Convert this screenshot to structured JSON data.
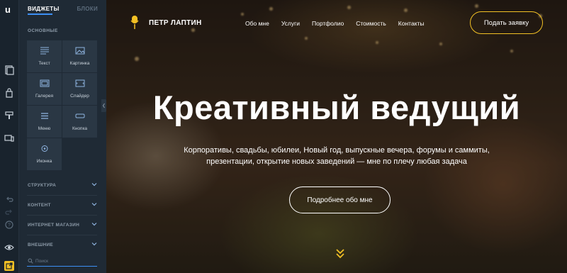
{
  "rail": {
    "logo": "u"
  },
  "panel": {
    "tabs": {
      "widgets": "ВИДЖЕТЫ",
      "blocks": "БЛОКИ"
    },
    "basic_title": "ОСНОВНЫЕ",
    "widgets": [
      "Текст",
      "Картинка",
      "Галерея",
      "Слайдер",
      "Меню",
      "Кнопка",
      "Иконка"
    ],
    "sections": [
      "СТРУКТУРА",
      "КОНТЕНТ",
      "ИНТЕРНЕТ МАГАЗИН",
      "ВНЕШНИЕ"
    ],
    "search_placeholder": "Поиск"
  },
  "site": {
    "brand": "ПЕТР ЛАПТИН",
    "menu": [
      "Обо мне",
      "Услуги",
      "Портфолио",
      "Стоимость",
      "Контакты"
    ],
    "cta": "Подать заявку",
    "headline": "Креативный ведущий",
    "subtitle": "Корпоративы, свадьбы, юбилеи, Новый год, выпускные вечера, форумы и саммиты, презентации, открытие новых заведений — мне по плечу любая задача",
    "more_button": "Подробнее обо мне"
  },
  "colors": {
    "accent": "#f2c024",
    "panel_accent": "#3d8ff5",
    "scroll_indicator": "#f2c024"
  }
}
